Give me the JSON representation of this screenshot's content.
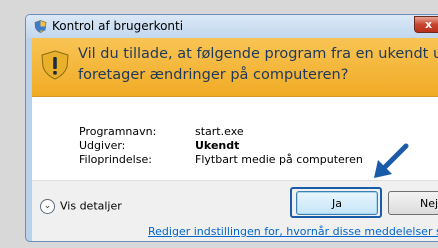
{
  "window": {
    "title": "Kontrol af brugerkonti",
    "close_label": "x"
  },
  "banner": {
    "line1": "Vil du tillade, at følgende program fra en ukendt udgiver",
    "line2": "foretager ændringer på computeren?"
  },
  "details": {
    "rows": [
      {
        "label": "Programnavn:",
        "value": "start.exe"
      },
      {
        "label": "Udgiver:",
        "value": "Ukendt"
      },
      {
        "label": "Filoprindelse:",
        "value": "Flytbart medie på computeren"
      }
    ]
  },
  "footer": {
    "show_details_label": "Vis detaljer",
    "yes_label": "Ja",
    "no_label": "Nej",
    "settings_link": "Rediger indstillingen for, hvornår disse meddelelser skal vises"
  },
  "colors": {
    "banner": "#f0ab25",
    "highlight_outline": "#1b5ca8",
    "link": "#0066cc"
  },
  "icons": {
    "title": "uac-shield-icon",
    "warning": "warning-shield-icon",
    "expand": "chevron-down-icon",
    "pointer": "pointing-arrow-icon"
  }
}
